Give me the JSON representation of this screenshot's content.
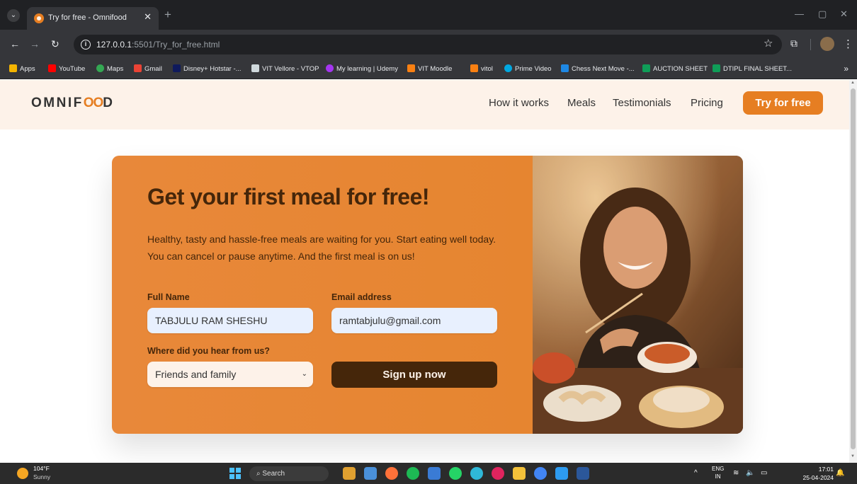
{
  "browser": {
    "tab_title": "Try for free - Omnifood",
    "url_host": "127.0.0.1",
    "url_path": ":5501/Try_for_free.html",
    "bookmarks": [
      {
        "label": "Apps",
        "color": "#f4b400"
      },
      {
        "label": "YouTube",
        "color": "#ff0000"
      },
      {
        "label": "Maps",
        "color": "#34a853"
      },
      {
        "label": "Gmail",
        "color": "#ea4335"
      },
      {
        "label": "Disney+ Hotstar -...",
        "color": "#0f1a5c"
      },
      {
        "label": "VIT Vellore - VTOP",
        "color": "#cfd8dc"
      },
      {
        "label": "My learning | Udemy",
        "color": "#a435f0"
      },
      {
        "label": "VIT Moodle",
        "color": "#f98012"
      },
      {
        "label": "vitol",
        "color": "#f98012"
      },
      {
        "label": "Prime Video",
        "color": "#00a8e1"
      },
      {
        "label": "Chess Next Move -...",
        "color": "#1e88e5"
      },
      {
        "label": "AUCTION SHEET",
        "color": "#0f9d58"
      },
      {
        "label": "DTIPL FINAL SHEET...",
        "color": "#0f9d58"
      }
    ]
  },
  "site": {
    "logo_pre": "OMNIF",
    "logo_oo": "OO",
    "logo_post": "D",
    "nav": [
      "How it works",
      "Meals",
      "Testimonials",
      "Pricing"
    ],
    "cta_label": "Try for free",
    "accent_color": "#e67e22"
  },
  "cta": {
    "heading": "Get your first meal for free!",
    "text": "Healthy, tasty and hassle-free meals are waiting for you. Start eating well today. You can cancel or pause anytime. And the first meal is on us!",
    "full_name_label": "Full Name",
    "full_name_value": "TABJULU RAM SHESHU",
    "email_label": "Email address",
    "email_value": "ramtabjulu@gmail.com",
    "source_label": "Where did you hear from us?",
    "source_selected": "Friends and family",
    "submit_label": "Sign up now"
  },
  "taskbar": {
    "temperature": "104°F",
    "condition": "Sunny",
    "search_label": "Search",
    "lang_1": "ENG",
    "lang_2": "IN",
    "time": "17:01",
    "date": "25-04-2024"
  }
}
